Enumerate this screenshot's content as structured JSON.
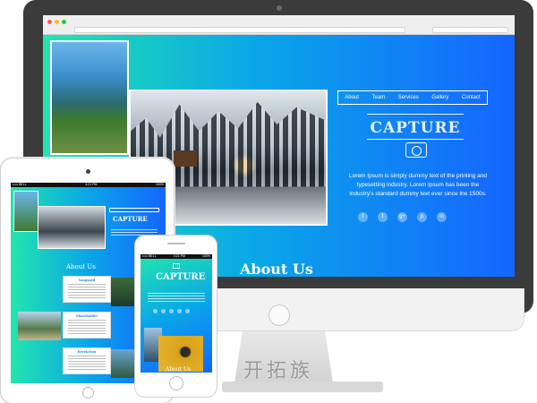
{
  "desktop": {
    "nav": [
      "About",
      "Team",
      "Services",
      "Gallery",
      "Contact"
    ],
    "brand": "CAPTURE",
    "description": "Lorem Ipsum is simply dummy text of the printing and typesetting industry. Lorem Ipsum has been the industry's standard dummy text ever since the 1500s.",
    "social": [
      {
        "name": "facebook-icon",
        "glyph": "f"
      },
      {
        "name": "twitter-icon",
        "glyph": "t"
      },
      {
        "name": "google-plus-icon",
        "glyph": "g+"
      },
      {
        "name": "pinterest-icon",
        "glyph": "p"
      },
      {
        "name": "linkedin-icon",
        "glyph": "in"
      }
    ],
    "section_title": "About Us"
  },
  "tablet": {
    "status_left": "••••• BELL",
    "status_time": "4:21 PM",
    "status_right": "100%",
    "brand": "CAPTURE",
    "section_title": "About Us",
    "cards": [
      "Vanguard",
      "Shareholder",
      "Revelation"
    ]
  },
  "phone": {
    "status_left": "••••• BELL",
    "status_time": "4:21 PM",
    "status_right": "100%",
    "brand": "CAPTURE",
    "section_title": "About Us"
  },
  "watermark": "开拓族",
  "colors": {
    "gradient_start": "#22e6ad",
    "gradient_mid": "#0aa6e8",
    "gradient_end": "#1565ff"
  }
}
